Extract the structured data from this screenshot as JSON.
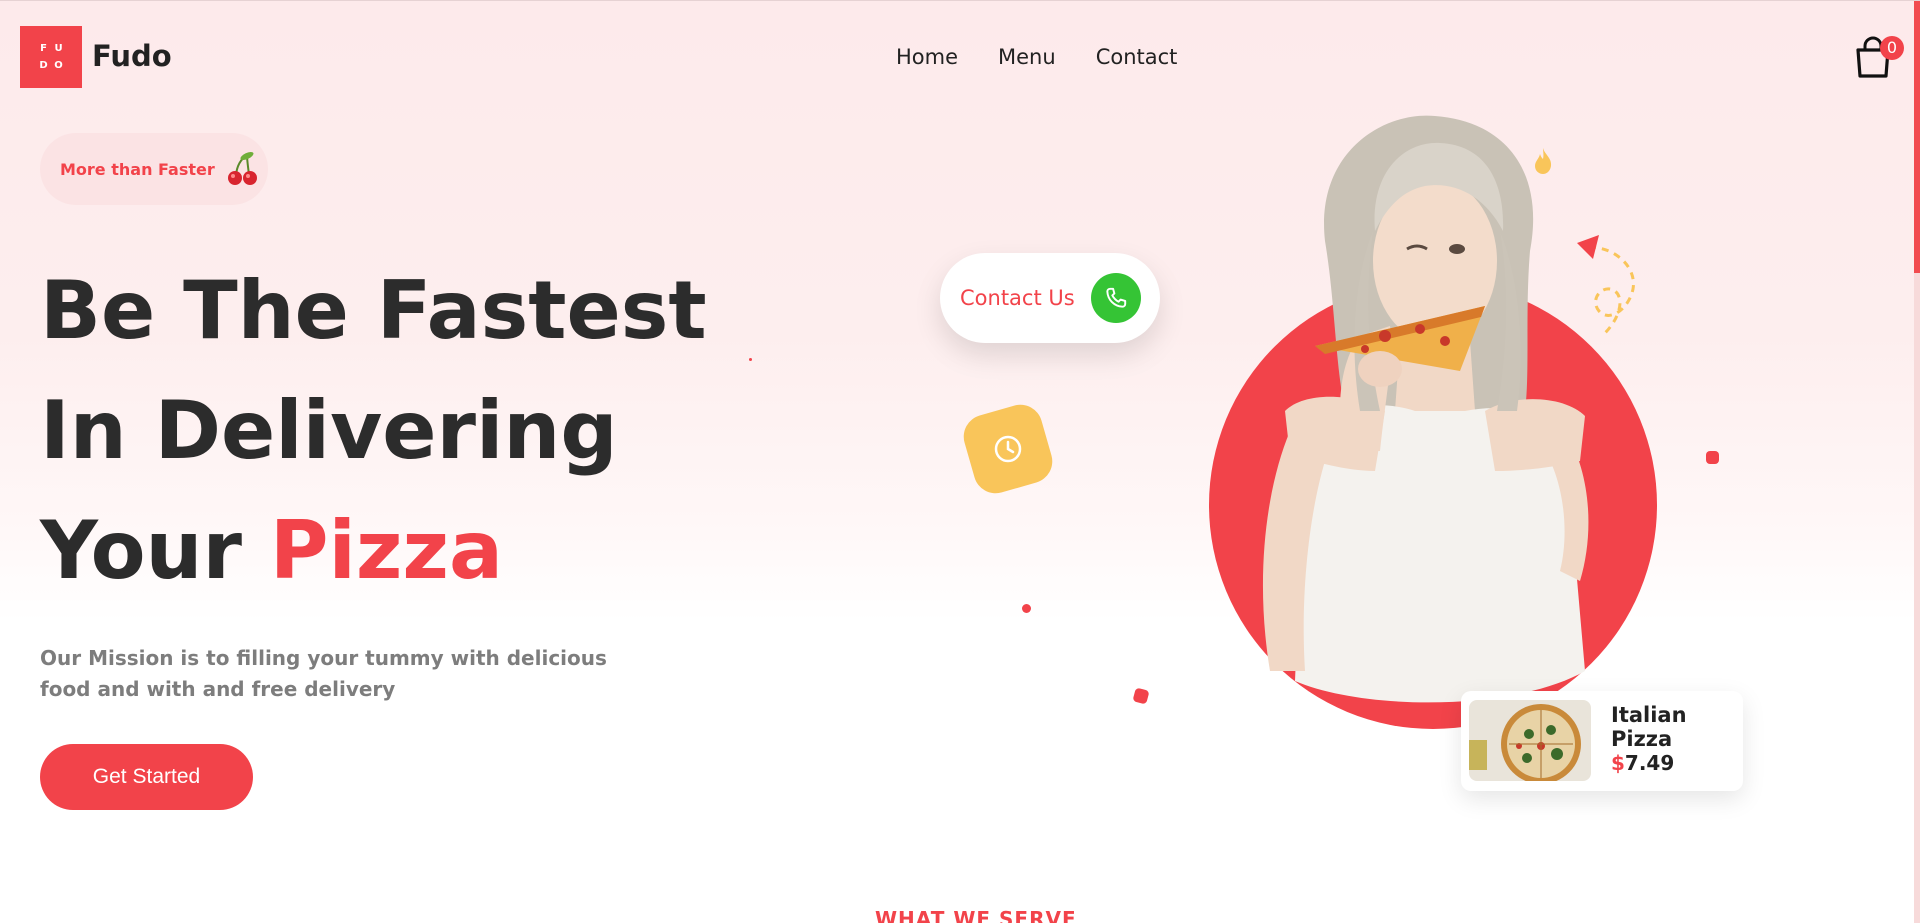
{
  "header": {
    "logo_letters": [
      "F",
      "U",
      "D",
      "O"
    ],
    "brand": "Fudo",
    "nav": [
      {
        "label": "Home"
      },
      {
        "label": "Menu"
      },
      {
        "label": "Contact"
      }
    ],
    "cart_count": "0"
  },
  "hero": {
    "badge": "More than Faster",
    "badge_icon": "cherries-icon",
    "headline_line1": "Be The Fastest",
    "headline_line2": "In Delivering",
    "headline_line3_prefix": "Your ",
    "headline_line3_accent": "Pizza",
    "mission": "Our Mission is to filling your tummy with delicious food and with and free delivery",
    "cta": "Get Started",
    "contact_label": "Contact Us",
    "contact_icon": "phone-icon",
    "clock_icon": "clock-icon"
  },
  "product": {
    "name": "Italian Pizza",
    "currency": "$",
    "price": "7.49"
  },
  "next_section": {
    "kicker": "WHAT WE SERVE"
  },
  "colors": {
    "accent": "#f2434a",
    "dark_text": "#2c2c2c",
    "muted_text": "#7d7d7d",
    "phone_green": "#35c435",
    "clock_yellow": "#f9c55a"
  }
}
